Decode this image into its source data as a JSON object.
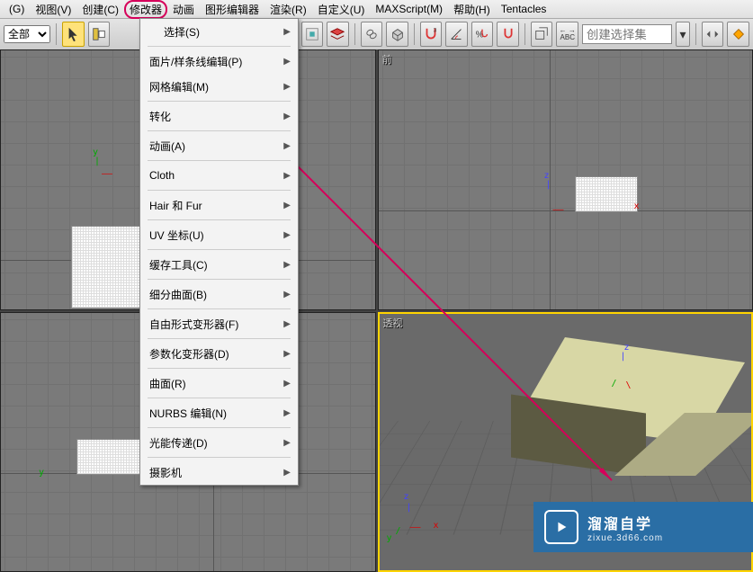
{
  "menubar": {
    "items": [
      "(G)",
      "视图(V)",
      "创建(C)",
      "修改器",
      "动画",
      "图形编辑器",
      "渲染(R)",
      "自定义(U)",
      "MAXScript(M)",
      "帮助(H)",
      "Tentacles"
    ],
    "highlighted_index": 3
  },
  "toolbar": {
    "filter_dropdown": "全部",
    "nameset_placeholder": "创建选择集"
  },
  "dropdown": {
    "items": [
      {
        "label": "选择(S)",
        "arrow": true,
        "obscured": true
      },
      {
        "div": true
      },
      {
        "label": "面片/样条线编辑(P)",
        "arrow": true
      },
      {
        "label": "网格编辑(M)",
        "arrow": true
      },
      {
        "div": true
      },
      {
        "label": "转化",
        "arrow": true
      },
      {
        "div": true
      },
      {
        "label": "动画(A)",
        "arrow": true
      },
      {
        "div": true
      },
      {
        "label": "Cloth",
        "arrow": true
      },
      {
        "div": true
      },
      {
        "label": "Hair 和 Fur",
        "arrow": true
      },
      {
        "div": true
      },
      {
        "label": "UV 坐标(U)",
        "arrow": true
      },
      {
        "div": true
      },
      {
        "label": "缓存工具(C)",
        "arrow": true
      },
      {
        "div": true
      },
      {
        "label": "细分曲面(B)",
        "arrow": true
      },
      {
        "div": true
      },
      {
        "label": "自由形式变形器(F)",
        "arrow": true
      },
      {
        "div": true
      },
      {
        "label": "参数化变形器(D)",
        "arrow": true
      },
      {
        "div": true
      },
      {
        "label": "曲面(R)",
        "arrow": true
      },
      {
        "div": true
      },
      {
        "label": "NURBS 编辑(N)",
        "arrow": true
      },
      {
        "div": true
      },
      {
        "label": "光能传递(D)",
        "arrow": true
      },
      {
        "div": true
      },
      {
        "label": "摄影机",
        "arrow": true
      }
    ]
  },
  "viewports": {
    "labels": [
      "",
      "前",
      "",
      "透视"
    ],
    "axes": {
      "x": "x",
      "y": "y",
      "z": "z"
    }
  },
  "watermark": {
    "title": "溜溜自学",
    "sub": "zixue.3d66.com"
  },
  "icons": {
    "cursor": "cursor",
    "magnet": "magnet",
    "angle": "angle",
    "percent": "percent",
    "snap": "snap",
    "abc": "abc",
    "view": "view",
    "link": "link"
  }
}
